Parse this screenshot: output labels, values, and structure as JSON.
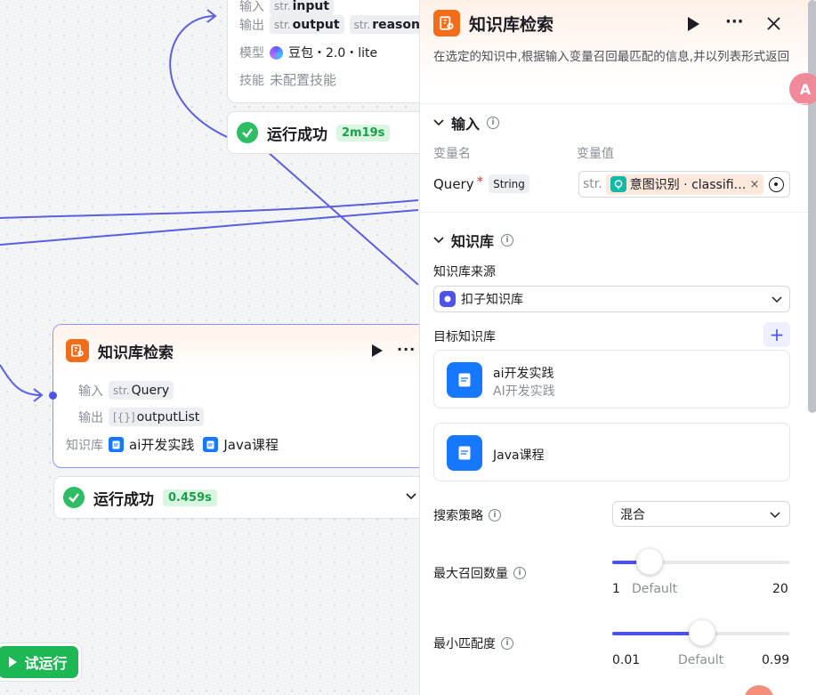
{
  "top_node": {
    "input_label": "输入",
    "input_tag_prefix": "str.",
    "input_tag": "input",
    "output_label": "输出",
    "output_tags": [
      {
        "prefix": "str.",
        "name": "output"
      },
      {
        "prefix": "str.",
        "name": "reasonin"
      }
    ],
    "model_label": "模型",
    "model_value": "豆包・2.0・lite",
    "skill_label": "技能",
    "skill_value": "未配置技能",
    "status": "运行成功",
    "duration": "2m19s"
  },
  "kb_node": {
    "title": "知识库检索",
    "input_label": "输入",
    "input_prefix": "str.",
    "input_value": "Query",
    "output_label": "输出",
    "output_prefix": "[{}]",
    "output_value": "outputList",
    "kb_label": "知识库",
    "kb_items": [
      "ai开发实践",
      "Java课程"
    ],
    "status": "运行成功",
    "duration": "0.459s"
  },
  "run_button": {
    "label": "试运行"
  },
  "panel": {
    "title": "知识库检索",
    "description": "在选定的知识中,根据输入变量召回最匹配的信息,并以列表形式返回",
    "input_section": {
      "title": "输入",
      "col_name": "变量名",
      "col_value": "变量值",
      "var_name": "Query",
      "required_mark": "*",
      "var_type": "String",
      "value_prefix": "str.",
      "value_ref": "意图识别 · classifi…"
    },
    "kb_section": {
      "title": "知识库",
      "source_label": "知识库来源",
      "source_value": "扣子知识库",
      "target_label": "目标知识库",
      "kbs": [
        {
          "name": "ai开发实践",
          "desc": "AI开发实践"
        },
        {
          "name": "Java课程",
          "desc": ""
        }
      ],
      "strategy_label": "搜索策略",
      "strategy_value": "混合",
      "max_recall": {
        "label": "最大召回数量",
        "min": "1",
        "default_label": "Default",
        "max": "20",
        "value": 5
      },
      "min_match": {
        "label": "最小匹配度",
        "min": "0.01",
        "default_label": "Default",
        "max": "0.99",
        "value": 0.5
      }
    }
  },
  "colors": {
    "accent": "#4d53e8",
    "success": "#2ebd62",
    "node_icon": "#f26d1a",
    "kb_icon": "#1677ff"
  }
}
